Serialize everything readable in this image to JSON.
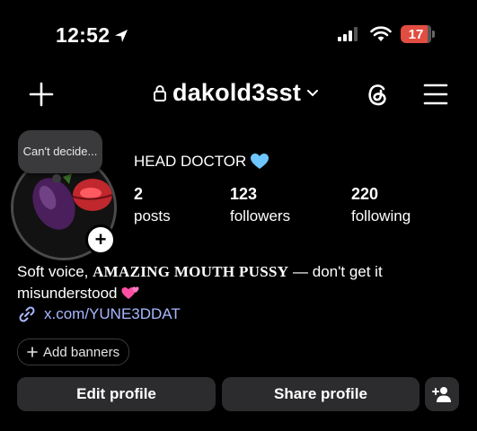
{
  "status_bar": {
    "time": "12:52",
    "battery": "17"
  },
  "header": {
    "username": "dakold3sst"
  },
  "profile": {
    "note": "Can't decide...",
    "display_name": "HEAD DOCTOR",
    "stats": [
      {
        "value": "2",
        "label": "posts"
      },
      {
        "value": "123",
        "label": "followers"
      },
      {
        "value": "220",
        "label": "following"
      }
    ],
    "bio_prefix": "Soft voice, ",
    "bio_caps": "AMAZING MOUTH PUSSY",
    "bio_suffix": " — don't get it misunderstood",
    "link": "x.com/YUNE3DDAT",
    "add_banners": "Add banners"
  },
  "actions": {
    "edit": "Edit profile",
    "share": "Share profile"
  },
  "colors": {
    "accent_link": "#a8b8ff",
    "heart_blue": "#6ec6ff",
    "heart_pink": "#ff4fa3",
    "battery_low": "#e24d41"
  }
}
